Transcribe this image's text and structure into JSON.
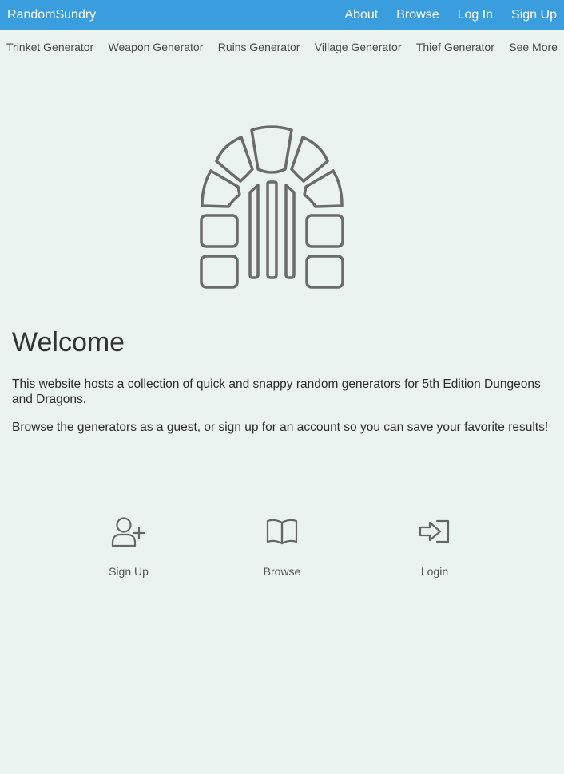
{
  "header": {
    "brand": "RandomSundry",
    "nav": [
      "About",
      "Browse",
      "Log In",
      "Sign Up"
    ]
  },
  "subnav": {
    "items": [
      "Trinket Generator",
      "Weapon Generator",
      "Ruins Generator",
      "Village Generator",
      "Thief Generator",
      "See More"
    ]
  },
  "main": {
    "logo_icon": "stone-archway-icon",
    "title": "Welcome",
    "paragraphs": [
      "This website hosts a collection of quick and snappy random generators for 5th Edition Dungeons and Dragons.",
      "Browse the generators as a guest, or sign up for an account so you can save your favorite results!"
    ],
    "actions": [
      {
        "label": "Sign Up",
        "icon": "user-plus-icon"
      },
      {
        "label": "Browse",
        "icon": "open-book-icon"
      },
      {
        "label": "Login",
        "icon": "login-arrow-icon"
      }
    ]
  },
  "colors": {
    "header_bg": "#3a9ede",
    "page_bg": "#ebf3f1",
    "icon_stroke": "#6b6b6b"
  }
}
